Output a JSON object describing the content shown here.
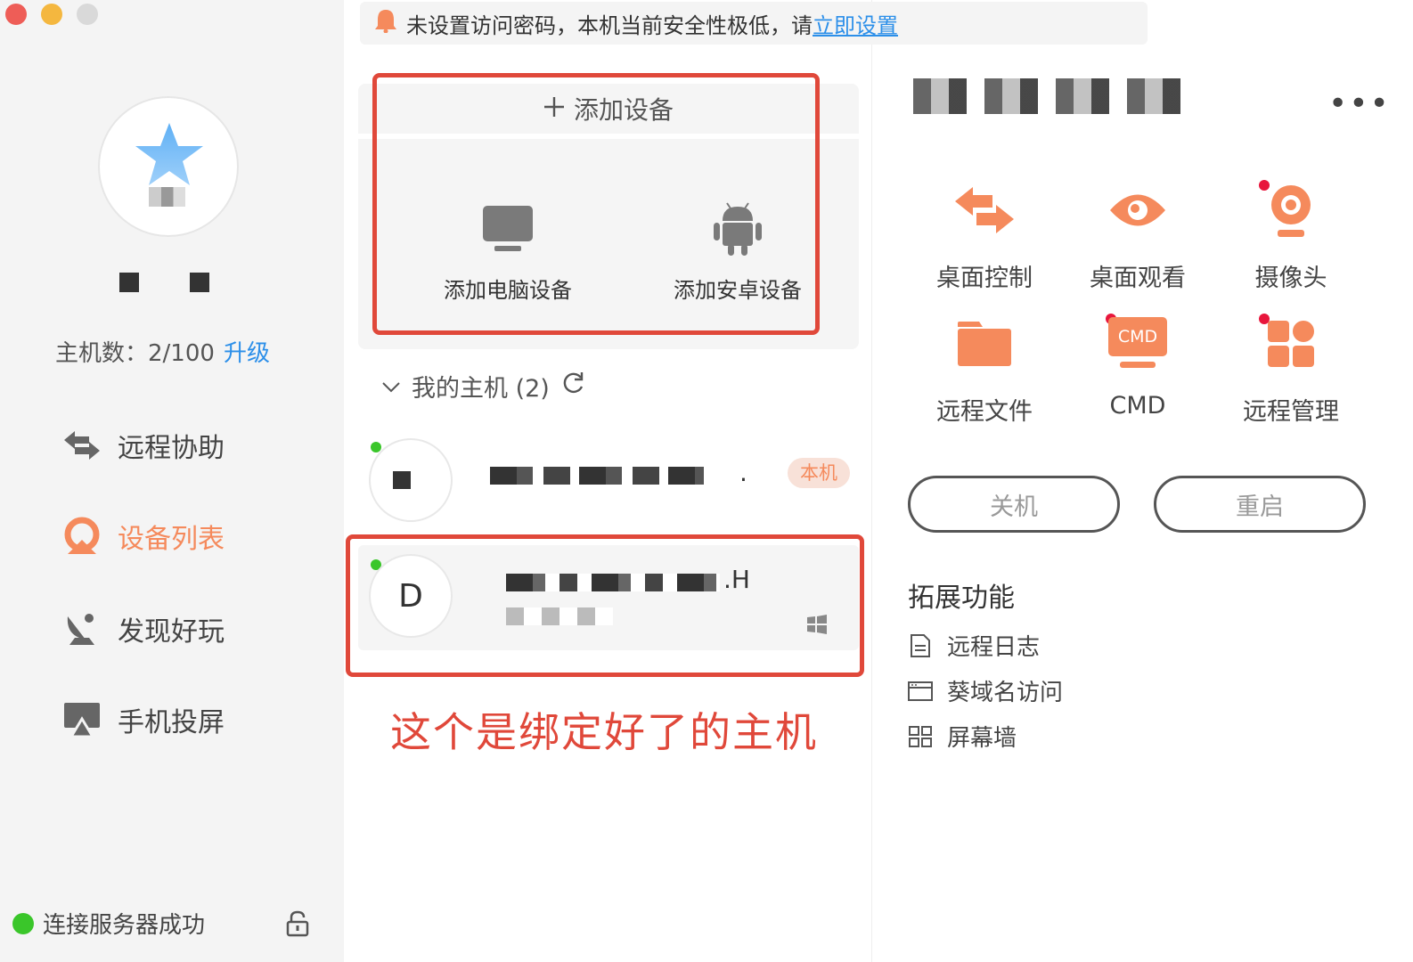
{
  "banner": {
    "text": "未设置访问密码，本机当前安全性极低，请",
    "link": "立即设置"
  },
  "sidebar": {
    "host_count_label": "主机数：2/100",
    "upgrade": "升级",
    "nav": [
      {
        "label": "远程协助",
        "icon": "arrows-swap-icon"
      },
      {
        "label": "设备列表",
        "icon": "device-list-icon",
        "active": true
      },
      {
        "label": "发现好玩",
        "icon": "satellite-dish-icon"
      },
      {
        "label": "手机投屏",
        "icon": "screen-cast-icon"
      }
    ],
    "status": "连接服务器成功"
  },
  "add_device": {
    "header": "添加设备",
    "options": [
      {
        "label": "添加电脑设备",
        "icon": "monitor-icon"
      },
      {
        "label": "添加安卓设备",
        "icon": "android-icon"
      }
    ]
  },
  "hosts": {
    "section_label": "我的主机 (2)",
    "items": [
      {
        "avatar": "",
        "suffix": ".",
        "badge": "本机"
      },
      {
        "avatar": "D",
        "suffix": ".H"
      }
    ]
  },
  "annotation": "这个是绑定好了的主机",
  "right": {
    "features": [
      {
        "label": "桌面控制",
        "icon": "desktop-control-icon"
      },
      {
        "label": "桌面观看",
        "icon": "eye-icon"
      },
      {
        "label": "摄像头",
        "icon": "camera-icon"
      },
      {
        "label": "远程文件",
        "icon": "folder-icon"
      },
      {
        "label": "CMD",
        "icon": "cmd-icon",
        "icon_text": "CMD"
      },
      {
        "label": "远程管理",
        "icon": "remote-manage-icon"
      }
    ],
    "shutdown": "关机",
    "restart": "重启",
    "ext_title": "拓展功能",
    "ext_items": [
      {
        "label": "远程日志",
        "icon": "log-document-icon"
      },
      {
        "label": "葵域名访问",
        "icon": "domain-window-icon"
      },
      {
        "label": "屏幕墙",
        "icon": "grid-icon"
      }
    ]
  },
  "colors": {
    "accent_orange": "#f58a5c",
    "link_blue": "#2c8fe9",
    "annotation_red": "#e0483a",
    "online_green": "#3ac62a"
  }
}
